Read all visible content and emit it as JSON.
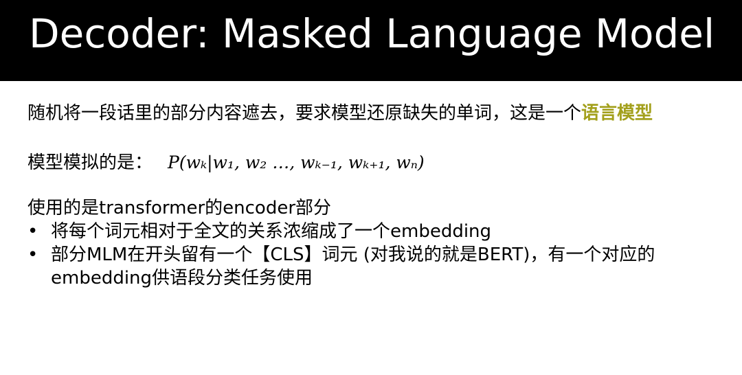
{
  "title": "Decoder: Masked Language Model",
  "para1": {
    "text": "随机将一段话里的部分内容遮去，要求模型还原缺失的单词，这是一个",
    "highlight": "语言模型",
    "highlight_color": "#a3a01c"
  },
  "para2": {
    "label": "模型模拟的是：",
    "formula": "P(wₖ|w₁, w₂ …, wₖ₋₁, wₖ₊₁, wₙ)"
  },
  "para3": {
    "heading": "使用的是transformer的encoder部分",
    "bullets": [
      {
        "marker": "•",
        "lines": [
          "将每个词元相对于全文的关系浓缩成了一个embedding"
        ]
      },
      {
        "marker": "•",
        "lines": [
          "部分MLM在开头留有一个【CLS】词元 (对我说的就是BERT)，有一个对应的",
          "embedding供语段分类任务使用"
        ]
      }
    ]
  }
}
